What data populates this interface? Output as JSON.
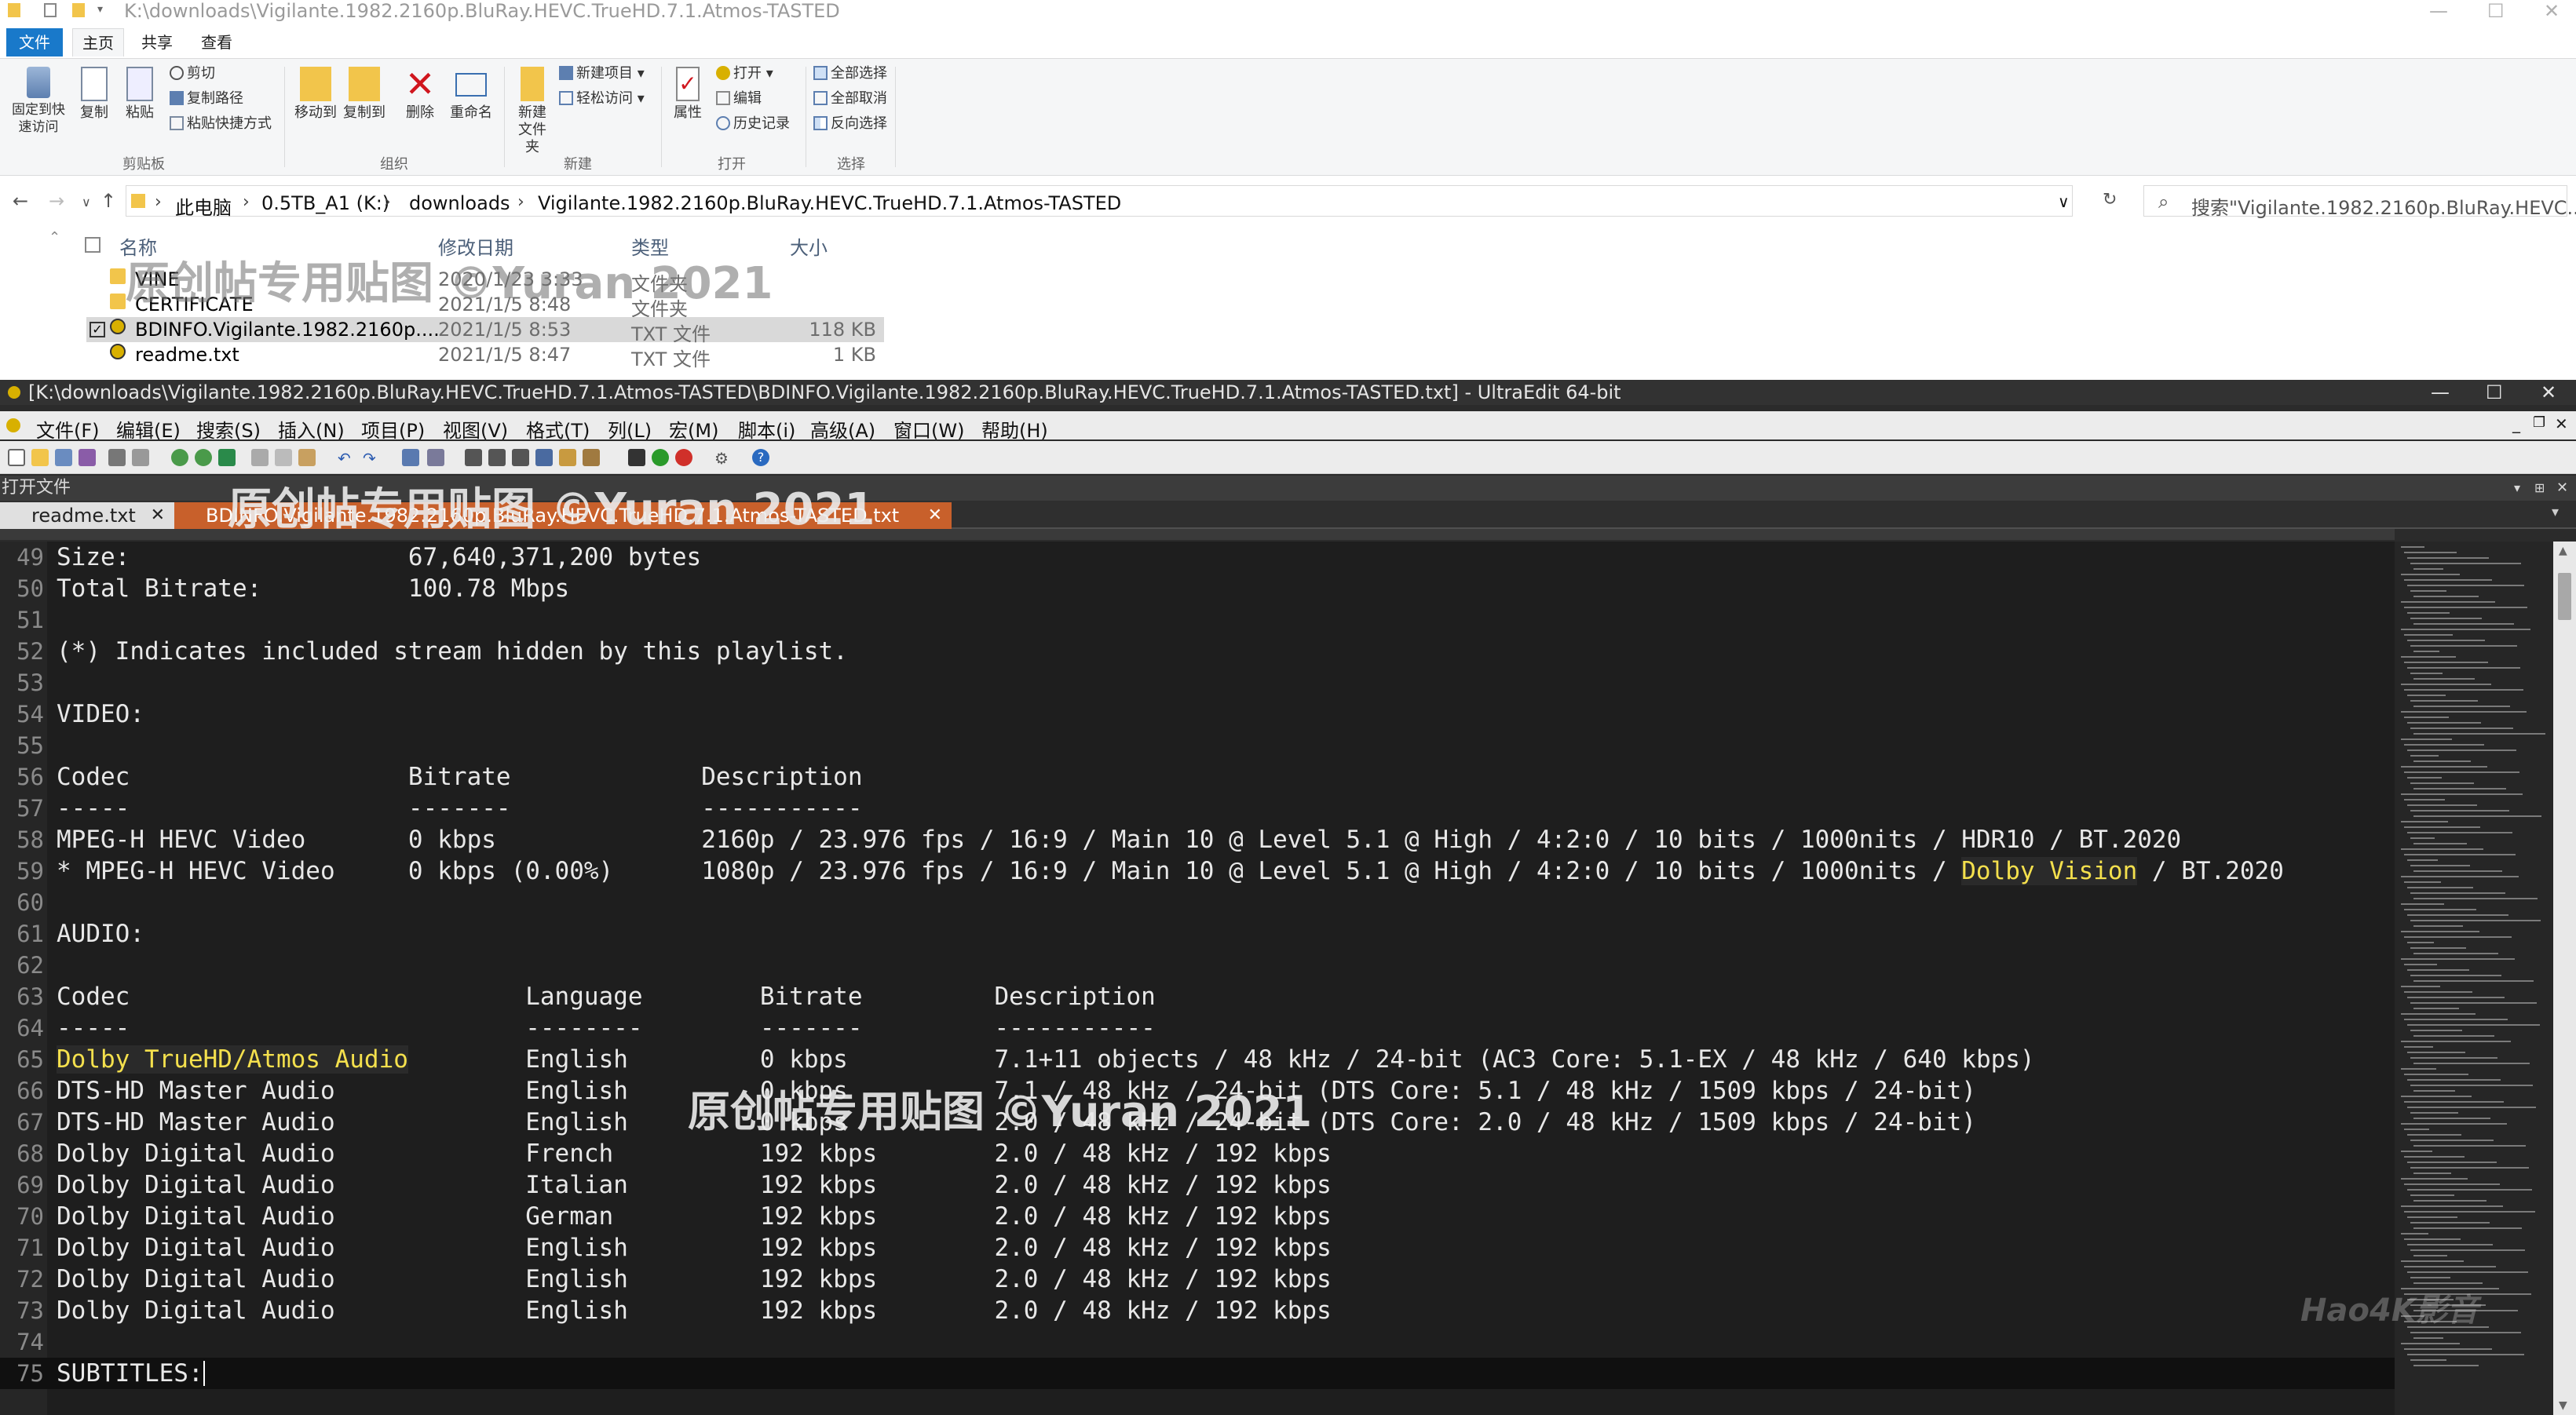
{
  "explorer": {
    "title": "K:\\downloads\\Vigilante.1982.2160p.BluRay.HEVC.TrueHD.7.1.Atmos-TASTED",
    "ribbon_tabs": [
      "文件",
      "主页",
      "共享",
      "查看"
    ],
    "groups": {
      "clipboard": {
        "label": "剪贴板",
        "pin": "固定到快速访问",
        "copy": "复制",
        "paste": "粘贴",
        "cut": "剪切",
        "copy_path": "复制路径",
        "paste_shortcut": "粘贴快捷方式"
      },
      "organize": {
        "label": "组织",
        "move_to": "移动到",
        "copy_to": "复制到",
        "delete": "删除",
        "rename": "重命名"
      },
      "new": {
        "label": "新建",
        "new_folder": "新建文件夹",
        "new_item": "新建项目",
        "easy_access": "轻松访问"
      },
      "open": {
        "label": "打开",
        "properties": "属性",
        "open": "打开",
        "edit": "编辑",
        "history": "历史记录"
      },
      "select": {
        "label": "选择",
        "select_all": "全部选择",
        "select_none": "全部取消",
        "invert": "反向选择"
      }
    },
    "breadcrumb": [
      "此电脑",
      "0.5TB_A1 (K:)",
      "downloads",
      "Vigilante.1982.2160p.BluRay.HEVC.TrueHD.7.1.Atmos-TASTED"
    ],
    "search_placeholder": "搜索\"Vigilante.1982.2160p.BluRay.HEVC....",
    "columns": {
      "name": "名称",
      "modified": "修改日期",
      "type": "类型",
      "size": "大小"
    },
    "files": [
      {
        "name": "VINE",
        "date": "2020/1/23 3:33",
        "type": "文件夹",
        "size": ""
      },
      {
        "name": "CERTIFICATE",
        "date": "2021/1/5 8:48",
        "type": "文件夹",
        "size": ""
      },
      {
        "name": "BDINFO.Vigilante.1982.2160p....",
        "date": "2021/1/5 8:53",
        "type": "TXT 文件",
        "size": "118 KB"
      },
      {
        "name": "readme.txt",
        "date": "2021/1/5 8:47",
        "type": "TXT 文件",
        "size": "1 KB"
      }
    ],
    "watermark": "原创帖专用贴图 ©Yuran 2021"
  },
  "ultraedit": {
    "title": "[K:\\downloads\\Vigilante.1982.2160p.BluRay.HEVC.TrueHD.7.1.Atmos-TASTED\\BDINFO.Vigilante.1982.2160p.BluRay.HEVC.TrueHD.7.1.Atmos-TASTED.txt] - UltraEdit 64-bit",
    "menu": [
      "文件(F)",
      "编辑(E)",
      "搜索(S)",
      "插入(N)",
      "项目(P)",
      "视图(V)",
      "格式(T)",
      "列(L)",
      "宏(M)",
      "脚本(i)",
      "高级(A)",
      "窗口(W)",
      "帮助(H)"
    ],
    "open_files_label": "打开文件",
    "tabs": [
      "readme.txt",
      "BDINFO.Vigilante.1982.2160p.BluRay.HEVC.TrueHD.7.1.Atmos-TASTED.txt"
    ],
    "watermark": "原创帖专用贴图 ©Yuran 2021",
    "corner_watermark": "Hao4K影音",
    "lines": [
      {
        "n": "49",
        "text": "Size:                   67,640,371,200 bytes"
      },
      {
        "n": "50",
        "text": "Total Bitrate:          100.78 Mbps"
      },
      {
        "n": "51",
        "text": ""
      },
      {
        "n": "52",
        "text": "(*) Indicates included stream hidden by this playlist."
      },
      {
        "n": "53",
        "text": ""
      },
      {
        "n": "54",
        "text": "VIDEO:"
      },
      {
        "n": "55",
        "text": ""
      },
      {
        "n": "56",
        "text": "Codec                   Bitrate             Description"
      },
      {
        "n": "57",
        "text": "-----                   -------             -----------"
      },
      {
        "n": "58",
        "text": "MPEG-H HEVC Video       0 kbps              2160p / 23.976 fps / 16:9 / Main 10 @ Level 5.1 @ High / 4:2:0 / 10 bits / 1000nits / HDR10 / BT.2020"
      },
      {
        "n": "59",
        "pre": "* MPEG-H HEVC Video     0 kbps (0.00%)      1080p / 23.976 fps / 16:9 / Main 10 @ Level 5.1 @ High / 4:2:0 / 10 bits / 1000nits / ",
        "hl": "Dolby Vision",
        "post": " / BT.2020"
      },
      {
        "n": "60",
        "text": ""
      },
      {
        "n": "61",
        "text": "AUDIO:"
      },
      {
        "n": "62",
        "text": ""
      },
      {
        "n": "63",
        "text": "Codec                           Language        Bitrate         Description"
      },
      {
        "n": "64",
        "text": "-----                           --------        -------         -----------"
      },
      {
        "n": "65",
        "pre": "",
        "hl": "Dolby TrueHD/Atmos Audio",
        "post": "        English         0 kbps          7.1+11 objects / 48 kHz / 24-bit (AC3 Core: 5.1-EX / 48 kHz / 640 kbps)"
      },
      {
        "n": "66",
        "text": "DTS-HD Master Audio             English         0 kbps          7.1 / 48 kHz / 24-bit (DTS Core: 5.1 / 48 kHz / 1509 kbps / 24-bit)"
      },
      {
        "n": "67",
        "text": "DTS-HD Master Audio             English         0 kbps          2.0 / 48 kHz / 24-bit (DTS Core: 2.0 / 48 kHz / 1509 kbps / 24-bit)"
      },
      {
        "n": "68",
        "text": "Dolby Digital Audio             French          192 kbps        2.0 / 48 kHz / 192 kbps"
      },
      {
        "n": "69",
        "text": "Dolby Digital Audio             Italian         192 kbps        2.0 / 48 kHz / 192 kbps"
      },
      {
        "n": "70",
        "text": "Dolby Digital Audio             German          192 kbps        2.0 / 48 kHz / 192 kbps"
      },
      {
        "n": "71",
        "text": "Dolby Digital Audio             English         192 kbps        2.0 / 48 kHz / 192 kbps"
      },
      {
        "n": "72",
        "text": "Dolby Digital Audio             English         192 kbps        2.0 / 48 kHz / 192 kbps"
      },
      {
        "n": "73",
        "text": "Dolby Digital Audio             English         192 kbps        2.0 / 48 kHz / 192 kbps"
      },
      {
        "n": "74",
        "text": ""
      },
      {
        "n": "75",
        "text": "SUBTITLES:"
      }
    ]
  },
  "colors": {
    "highlight_text": "#f4e04d",
    "active_tab": "#c8602b",
    "editor_bg": "#1e1e1e",
    "file_tab": "#1979ca"
  }
}
